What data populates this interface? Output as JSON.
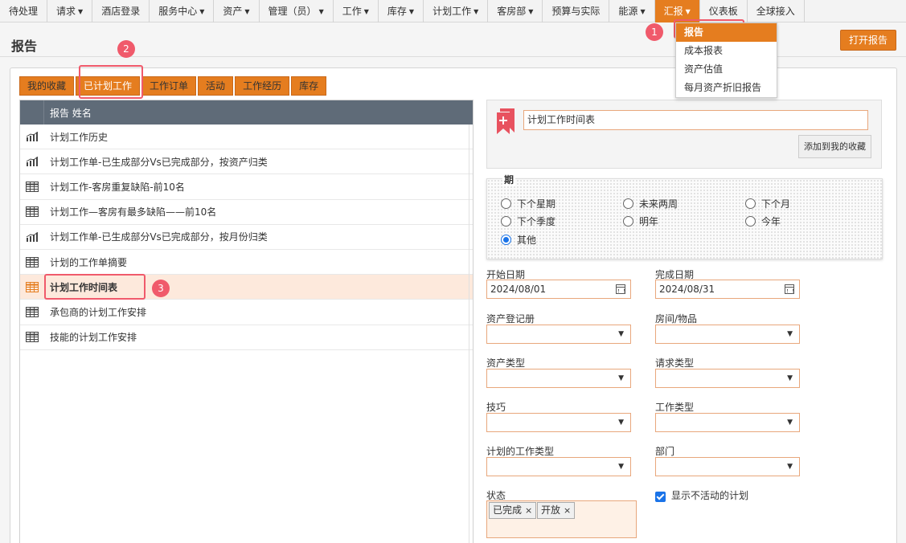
{
  "nav": {
    "items": [
      {
        "label": "待处理",
        "caret": false
      },
      {
        "label": "请求",
        "caret": true
      },
      {
        "label": "酒店登录",
        "caret": false
      },
      {
        "label": "服务中心",
        "caret": true
      },
      {
        "label": "资产",
        "caret": true
      },
      {
        "label": "管理（员）",
        "caret": true
      },
      {
        "label": "工作",
        "caret": true
      },
      {
        "label": "库存",
        "caret": true
      },
      {
        "label": "计划工作",
        "caret": true
      },
      {
        "label": "客房部",
        "caret": true
      },
      {
        "label": "预算与实际",
        "caret": false
      },
      {
        "label": "能源",
        "caret": true
      },
      {
        "label": "汇报",
        "caret": true,
        "active": true
      },
      {
        "label": "仪表板",
        "caret": false
      },
      {
        "label": "全球接入",
        "caret": false
      }
    ],
    "caret_glyph": "▼"
  },
  "report_menu": {
    "items": [
      "报告",
      "成本报表",
      "资产估值",
      "每月资产折旧报告"
    ],
    "active_index": 0
  },
  "page": {
    "title": "报告",
    "open_report_button": "打开报告"
  },
  "tabs": [
    "我的收藏",
    "已计划工作",
    "工作订单",
    "活动",
    "工作经历",
    "库存"
  ],
  "active_tab": 1,
  "list": {
    "header_label": "报告 姓名",
    "rows": [
      {
        "label": "计划工作历史",
        "icon": "chart-icon"
      },
      {
        "label": "计划工作单-已生成部分Vs已完成部分，按资产归类",
        "icon": "chart-icon"
      },
      {
        "label": "计划工作-客房重复缺陷-前10名",
        "icon": "table-icon"
      },
      {
        "label": "计划工作—客房有最多缺陷——前10名",
        "icon": "table-icon"
      },
      {
        "label": "计划工作单-已生成部分Vs已完成部分，按月份归类",
        "icon": "chart-icon"
      },
      {
        "label": "计划的工作单摘要",
        "icon": "table-icon"
      },
      {
        "label": "计划工作时间表",
        "icon": "table-icon",
        "selected": true
      },
      {
        "label": "承包商的计划工作安排",
        "icon": "table-icon"
      },
      {
        "label": "技能的计划工作安排",
        "icon": "table-icon"
      }
    ]
  },
  "favorites": {
    "report_name": "计划工作时间表",
    "add_button": "添加到我的收藏"
  },
  "period": {
    "label": "期",
    "options": [
      "下个星期",
      "未来两周",
      "下个月",
      "下个季度",
      "明年",
      "今年",
      "其他"
    ],
    "selected": "其他"
  },
  "fields": {
    "start_date_label": "开始日期",
    "start_date": "2024/08/01",
    "end_date_label": "完成日期",
    "end_date": "2024/08/31",
    "asset_register_label": "资产登记册",
    "room_label": "房间/物品",
    "asset_type_label": "资产类型",
    "request_type_label": "请求类型",
    "skill_label": "技巧",
    "work_type_label": "工作类型",
    "planned_work_type_label": "计划的工作类型",
    "department_label": "部门",
    "status_label": "状态",
    "status_chips": [
      "已完成",
      "开放"
    ],
    "show_inactive_label": "显示不活动的计划",
    "show_inactive_checked": true
  },
  "annotations": [
    "1",
    "2",
    "3"
  ],
  "colors": {
    "accent": "#e57d1f",
    "highlight": "#f05a6b",
    "list_header": "#5f6b78",
    "selected_row": "#fde9dc"
  }
}
